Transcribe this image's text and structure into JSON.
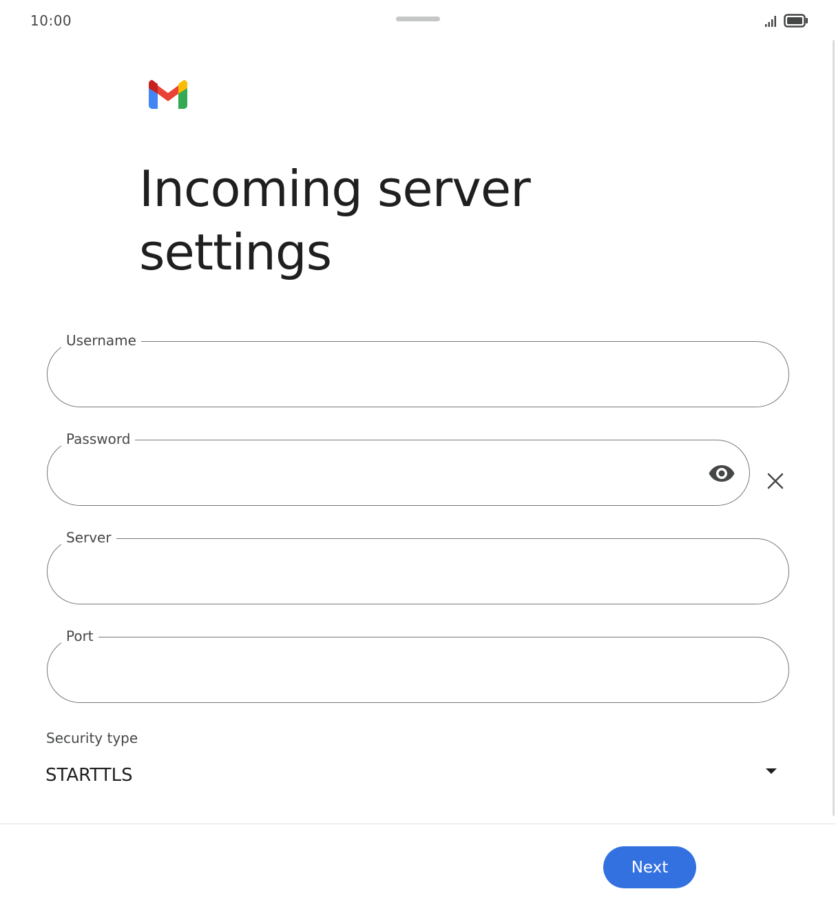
{
  "status_bar": {
    "time": "10:00",
    "signal_icon": "signal-icon",
    "battery_icon": "battery-icon"
  },
  "header": {
    "logo_icon": "gmail-logo",
    "title": "Incoming server settings"
  },
  "form": {
    "username": {
      "label": "Username",
      "value": ""
    },
    "password": {
      "label": "Password",
      "value": "",
      "visibility_icon": "eye-icon",
      "clear_icon": "close-icon"
    },
    "server": {
      "label": "Server",
      "value": ""
    },
    "port": {
      "label": "Port",
      "value": ""
    },
    "security_type": {
      "label": "Security type",
      "value": "STARTTLS",
      "dropdown_icon": "dropdown-arrow-icon"
    }
  },
  "footer": {
    "next_label": "Next"
  },
  "colors": {
    "primary": "#3371e0",
    "outline": "#747775",
    "text": "#1f1f1f",
    "secondary_text": "#444746"
  }
}
